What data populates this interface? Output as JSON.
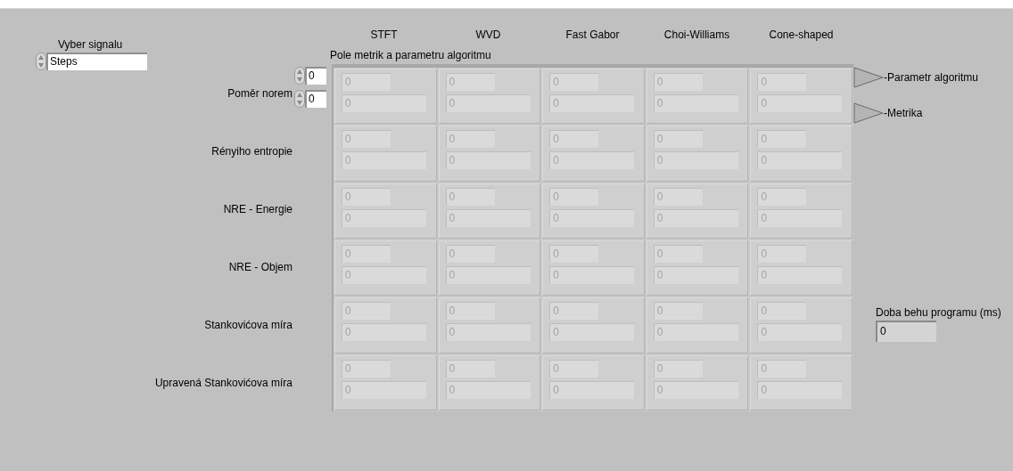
{
  "signal": {
    "label": "Vyber signalu",
    "value": "Steps"
  },
  "columns": [
    "STFT",
    "WVD",
    "Fast Gabor",
    "Choi-Williams",
    "Cone-shaped"
  ],
  "array": {
    "label": "Pole metrik a parametru algoritmu",
    "disabled": true,
    "index": [
      "0",
      "0"
    ],
    "rows": [
      {
        "label": "Poměr norem",
        "cells": [
          {
            "parameter": "0",
            "metric": "0"
          },
          {
            "parameter": "0",
            "metric": "0"
          },
          {
            "parameter": "0",
            "metric": "0"
          },
          {
            "parameter": "0",
            "metric": "0"
          },
          {
            "parameter": "0",
            "metric": "0"
          }
        ]
      },
      {
        "label": "Rényiho entropie",
        "cells": [
          {
            "parameter": "0",
            "metric": "0"
          },
          {
            "parameter": "0",
            "metric": "0"
          },
          {
            "parameter": "0",
            "metric": "0"
          },
          {
            "parameter": "0",
            "metric": "0"
          },
          {
            "parameter": "0",
            "metric": "0"
          }
        ]
      },
      {
        "label": "NRE - Energie",
        "cells": [
          {
            "parameter": "0",
            "metric": "0"
          },
          {
            "parameter": "0",
            "metric": "0"
          },
          {
            "parameter": "0",
            "metric": "0"
          },
          {
            "parameter": "0",
            "metric": "0"
          },
          {
            "parameter": "0",
            "metric": "0"
          }
        ]
      },
      {
        "label": "NRE - Objem",
        "cells": [
          {
            "parameter": "0",
            "metric": "0"
          },
          {
            "parameter": "0",
            "metric": "0"
          },
          {
            "parameter": "0",
            "metric": "0"
          },
          {
            "parameter": "0",
            "metric": "0"
          },
          {
            "parameter": "0",
            "metric": "0"
          }
        ]
      },
      {
        "label": "Stankovićova míra",
        "cells": [
          {
            "parameter": "0",
            "metric": "0"
          },
          {
            "parameter": "0",
            "metric": "0"
          },
          {
            "parameter": "0",
            "metric": "0"
          },
          {
            "parameter": "0",
            "metric": "0"
          },
          {
            "parameter": "0",
            "metric": "0"
          }
        ]
      },
      {
        "label": "Upravená Stankovićova míra",
        "cells": [
          {
            "parameter": "0",
            "metric": "0"
          },
          {
            "parameter": "0",
            "metric": "0"
          },
          {
            "parameter": "0",
            "metric": "0"
          },
          {
            "parameter": "0",
            "metric": "0"
          },
          {
            "parameter": "0",
            "metric": "0"
          }
        ]
      }
    ]
  },
  "legend": [
    "-Parametr algoritmu",
    "-Metrika"
  ],
  "runtime": {
    "label": "Doba behu programu (ms)",
    "value": "0"
  }
}
